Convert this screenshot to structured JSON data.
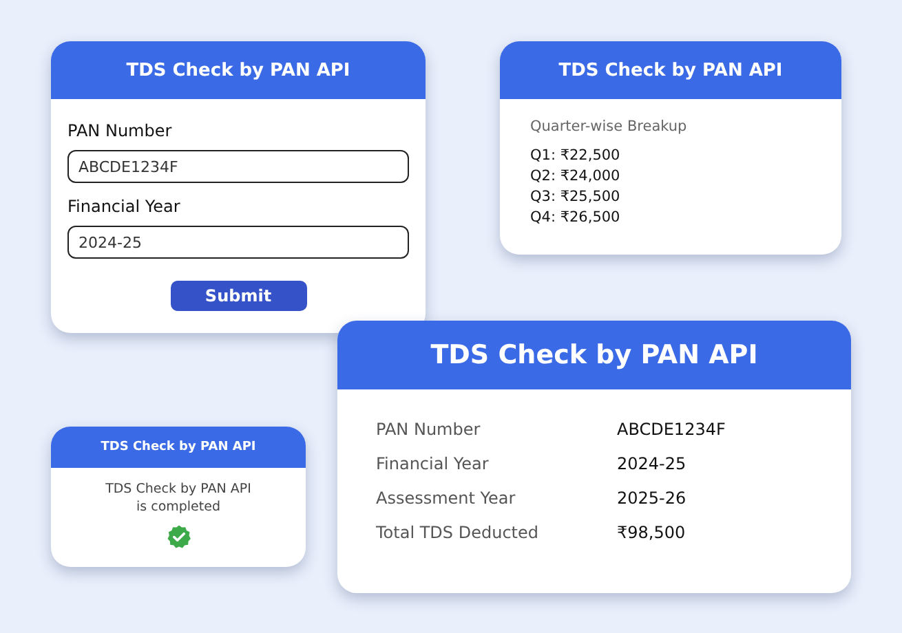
{
  "form_card": {
    "title": "TDS Check by PAN API",
    "fields": [
      {
        "label": "PAN Number",
        "value": "ABCDE1234F"
      },
      {
        "label": "Financial Year",
        "value": "2024-25"
      }
    ],
    "button": "Submit"
  },
  "breakup_card": {
    "title": "TDS Check by PAN API",
    "heading": "Quarter-wise Breakup",
    "items": [
      "Q1: ₹22,500",
      "Q2: ₹24,000",
      "Q3: ₹25,500",
      "Q4: ₹26,500"
    ]
  },
  "status_card": {
    "title": "TDS Check by PAN API",
    "message": "TDS Check by PAN API",
    "message_line_2": "is completed"
  },
  "result_card": {
    "title": "TDS Check by PAN API",
    "rows": [
      {
        "label": "PAN Number",
        "value": "ABCDE1234F"
      },
      {
        "label": "Financial Year",
        "value": "2024-25"
      },
      {
        "label": "Assessment Year",
        "value": "2025-26"
      },
      {
        "label": "Total TDS Deducted",
        "value": "₹98,500"
      }
    ]
  }
}
